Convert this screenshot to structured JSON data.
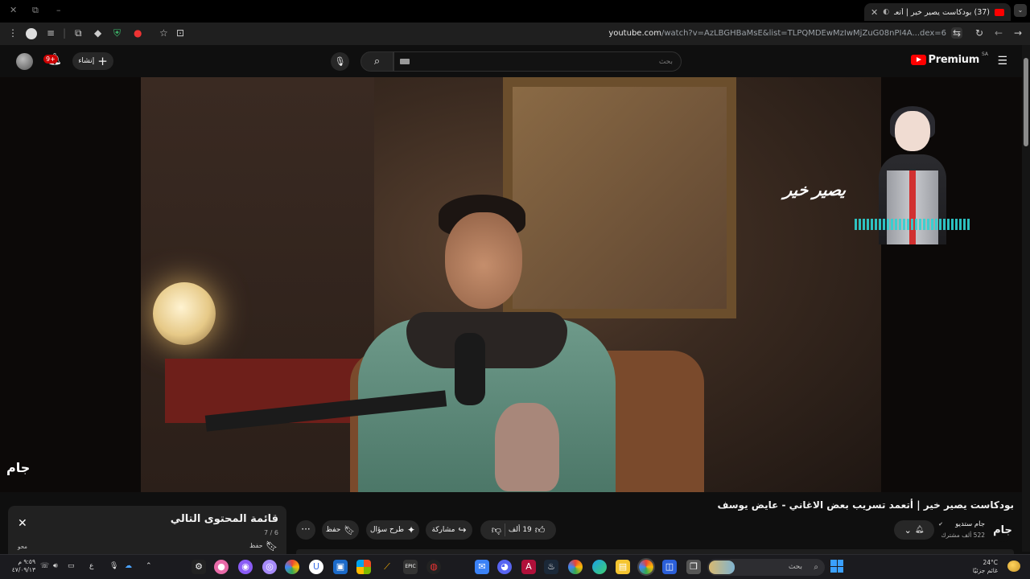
{
  "browser": {
    "tab_title": "(37) بودكاست يصير خير | أتعـ",
    "new_tab": "+",
    "url_host": "youtube.com",
    "url_path": "/watch?v=AzLBGHBaMsE&list=TLPQMDEwMzIwMjZuG08nPI4A...dex=6",
    "controls": {
      "minimize": "–",
      "restore": "⧉",
      "close": "✕",
      "tab_close": "✕"
    }
  },
  "masthead": {
    "notifications_badge": "9+",
    "create_label": "إنشاء",
    "search_placeholder": "بحث",
    "logo_word": "Premium",
    "country_code": "SA"
  },
  "player": {
    "watermark_logo": "يصير خير",
    "corner_watermark": "جام"
  },
  "video": {
    "title": "بودكاست يصير خير | أتعمد تسريب بعض الاغاني - عايض يوسف",
    "channel_avatar_text": "جام",
    "channel_name": "جام ستديو",
    "channel_subs": "522 ألف مشترك",
    "like_count": "19 ألف",
    "share_label": "مشاركة",
    "ask_label": "طرح سؤال",
    "save_label": "حفظ",
    "more_label": "···"
  },
  "queue": {
    "title": "قائمة المحتوى التالي",
    "count": "7 / 6",
    "save_label": "حفظ",
    "edit_label": "محو"
  },
  "taskbar": {
    "clock_time": "٩:٥٩ م",
    "clock_date": "٤٧/٠٩/١٣",
    "language": "ع",
    "search_placeholder": "بحث",
    "weather_temp": "24°C",
    "weather_desc": "غائم جزئيًا"
  },
  "colors": {
    "accent": "#ff0000",
    "background": "#0f0f0f",
    "pill": "#272727",
    "taskbar": "#1b1b1f"
  },
  "icons": [
    "avatar",
    "bell-icon",
    "plus-icon",
    "mic-icon",
    "search-icon",
    "keyboard-icon",
    "youtube-logo-icon",
    "hamburger-icon",
    "bell-icon",
    "chevron-down-icon",
    "like-icon",
    "dislike-icon",
    "share-icon",
    "sparkle-icon",
    "save-icon",
    "more-icon",
    "close-icon",
    "windows-start-icon",
    "weather-icon"
  ]
}
